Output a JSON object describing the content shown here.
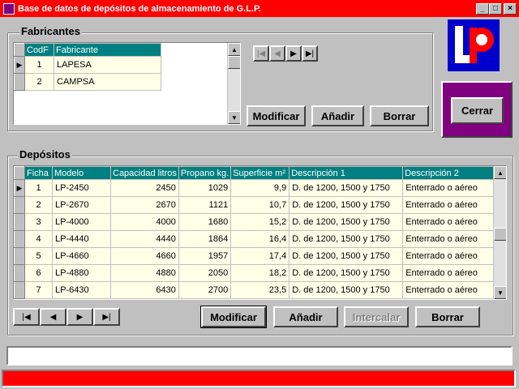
{
  "window": {
    "title": "Base de datos de depósitos de almacenamiento de G.L.P."
  },
  "logo": {
    "text": "LP"
  },
  "fabricantes": {
    "title": "Fabricantes",
    "columns": [
      "CodF",
      "Fabricante"
    ],
    "rows": [
      {
        "codf": "1",
        "fabricante": "LAPESA"
      },
      {
        "codf": "2",
        "fabricante": "CAMPSA"
      }
    ],
    "buttons": {
      "modificar": "Modificar",
      "anadir": "Añadir",
      "borrar": "Borrar"
    }
  },
  "cerrar": "Cerrar",
  "depositos": {
    "title": "Depósitos",
    "columns": [
      "Ficha",
      "Modelo",
      "Capacidad litros",
      "Propano kg.",
      "Superficie m²",
      "Descripción 1",
      "Descripción 2"
    ],
    "rows": [
      {
        "ficha": "1",
        "modelo": "LP-2450",
        "capacidad": "2450",
        "propano": "1029",
        "superficie": "9,9",
        "desc1": "D. de 1200, 1500 y 1750",
        "desc2": "Enterrado o aéreo"
      },
      {
        "ficha": "2",
        "modelo": "LP-2670",
        "capacidad": "2670",
        "propano": "1121",
        "superficie": "10,7",
        "desc1": "D. de 1200, 1500 y 1750",
        "desc2": "Enterrado o aéreo"
      },
      {
        "ficha": "3",
        "modelo": "LP-4000",
        "capacidad": "4000",
        "propano": "1680",
        "superficie": "15,2",
        "desc1": "D. de 1200, 1500 y 1750",
        "desc2": "Enterrado o aéreo"
      },
      {
        "ficha": "4",
        "modelo": "LP-4440",
        "capacidad": "4440",
        "propano": "1864",
        "superficie": "16,4",
        "desc1": "D. de 1200, 1500 y 1750",
        "desc2": "Enterrado o aéreo"
      },
      {
        "ficha": "5",
        "modelo": "LP-4660",
        "capacidad": "4660",
        "propano": "1957",
        "superficie": "17,4",
        "desc1": "D. de 1200, 1500 y 1750",
        "desc2": "Enterrado o aéreo"
      },
      {
        "ficha": "6",
        "modelo": "LP-4880",
        "capacidad": "4880",
        "propano": "2050",
        "superficie": "18,2",
        "desc1": "D. de 1200, 1500 y 1750",
        "desc2": "Enterrado o aéreo"
      },
      {
        "ficha": "7",
        "modelo": "LP-6430",
        "capacidad": "6430",
        "propano": "2700",
        "superficie": "23,5",
        "desc1": "D. de 1200, 1500 y 1750",
        "desc2": "Enterrado o aéreo"
      }
    ],
    "buttons": {
      "modificar": "Modificar",
      "anadir": "Añadir",
      "intercalar": "Intercalar",
      "borrar": "Borrar"
    }
  },
  "status_text": ""
}
